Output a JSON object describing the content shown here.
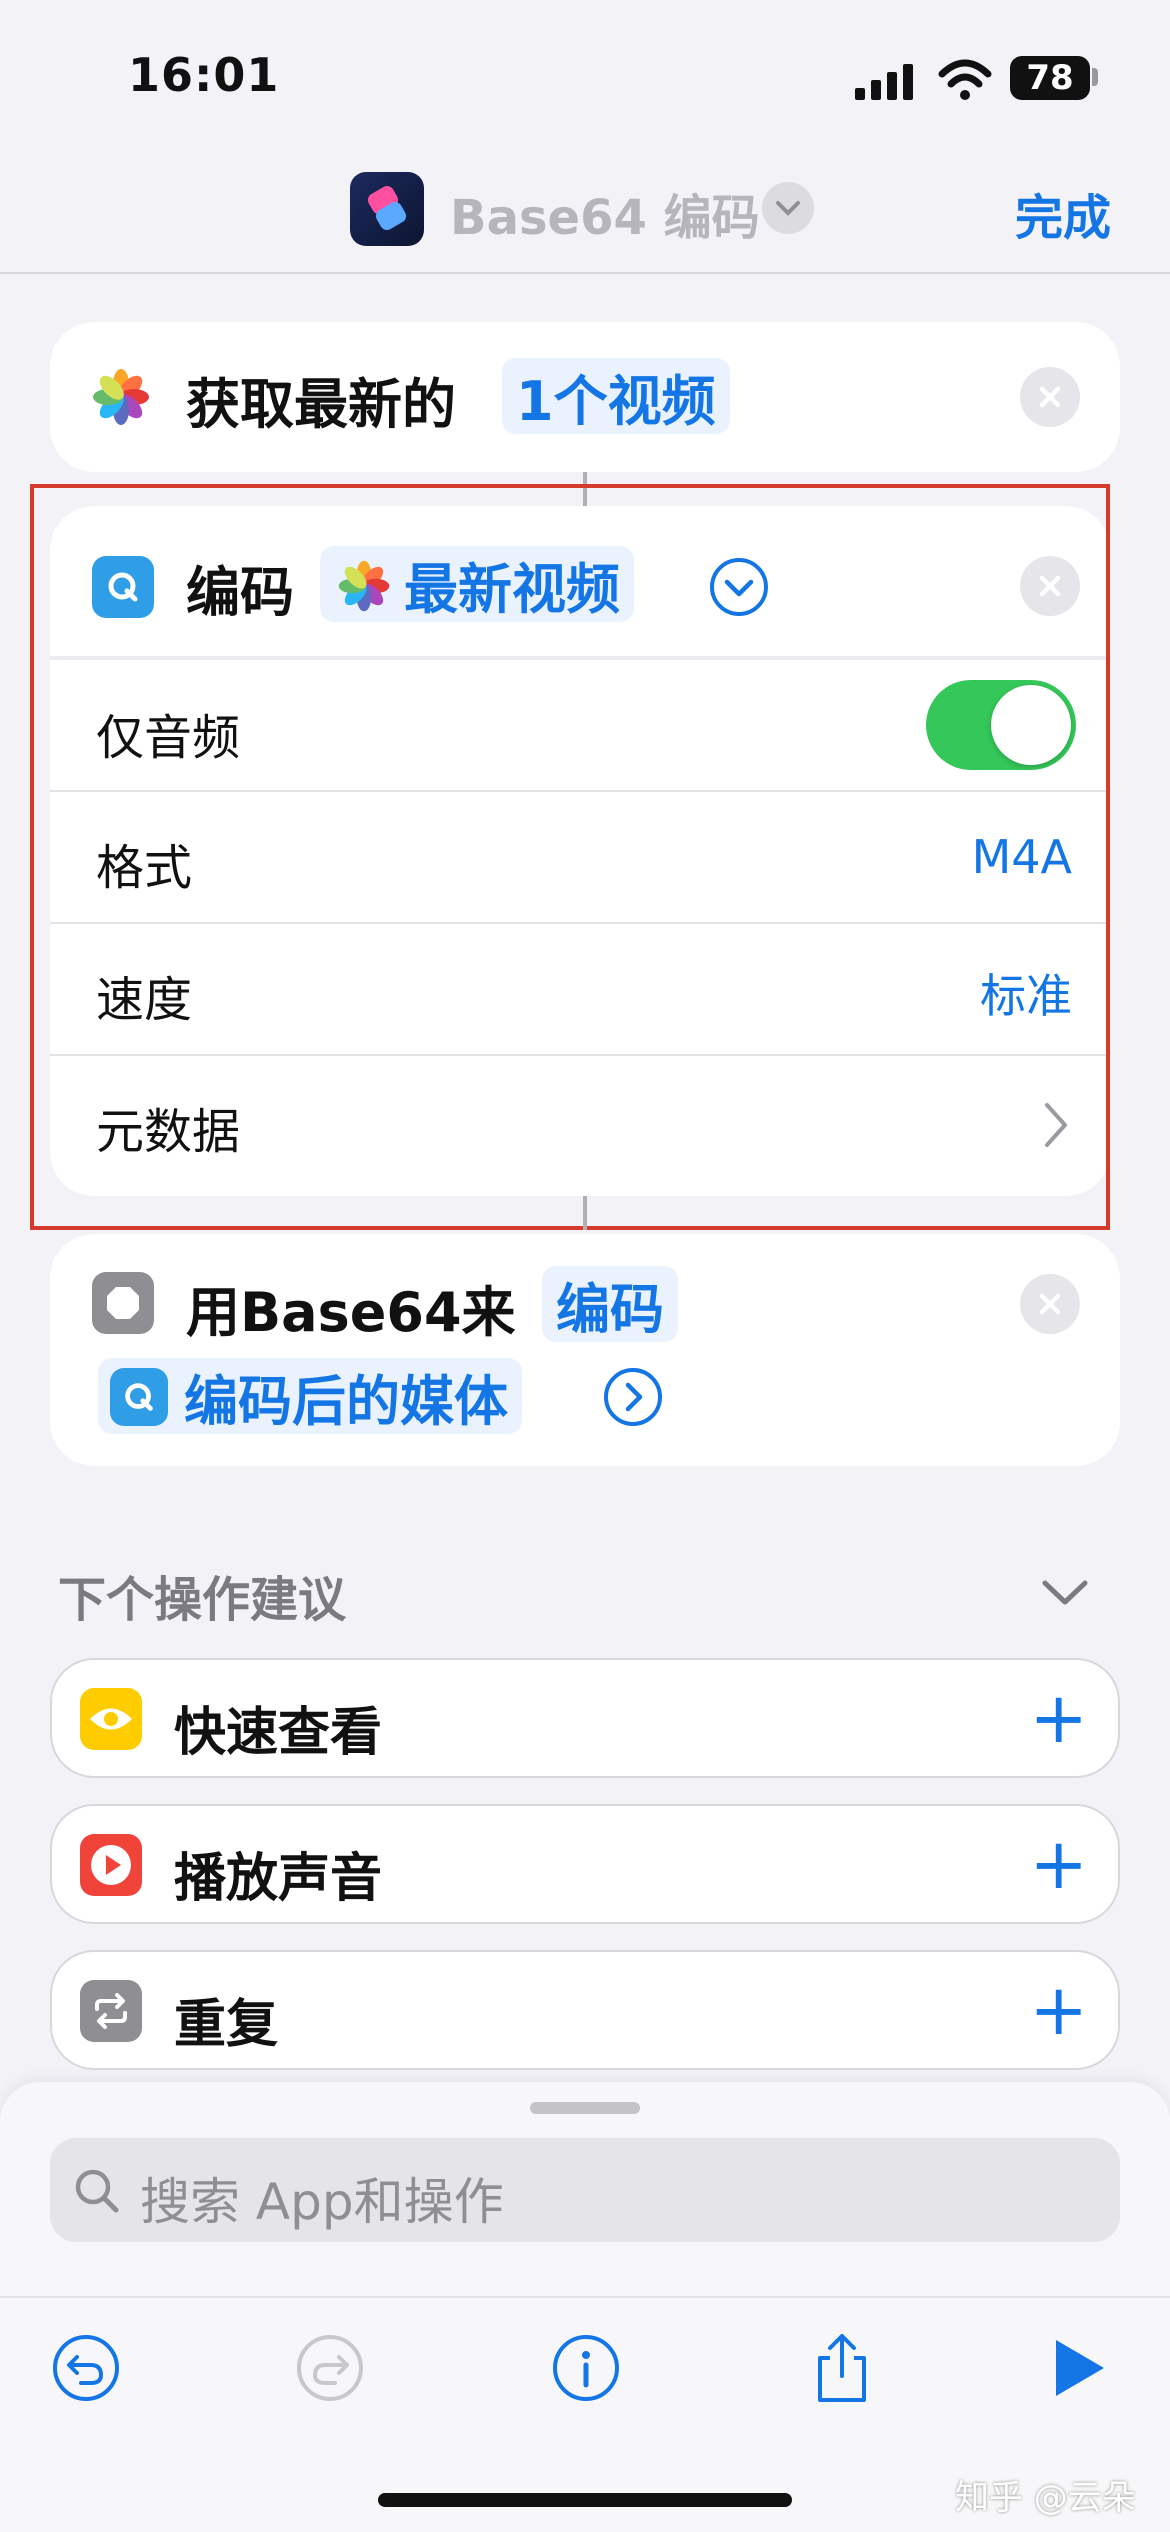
{
  "status_bar": {
    "time": "16:01",
    "battery": "78"
  },
  "nav": {
    "title": "Base64 编码",
    "done": "完成"
  },
  "action1": {
    "text": "获取最新的",
    "token": "1个视频"
  },
  "action2": {
    "verb": "编码",
    "token": "最新视频",
    "rows": [
      {
        "label": "仅音频",
        "value": "",
        "toggle_on": true
      },
      {
        "label": "格式",
        "value": "M4A"
      },
      {
        "label": "速度",
        "value": "标准"
      },
      {
        "label": "元数据",
        "value": ""
      }
    ]
  },
  "action3": {
    "prefix": "用",
    "mid": "Base64",
    "suffix": "来",
    "token": "编码",
    "token2": "编码后的媒体"
  },
  "suggestions": {
    "header": "下个操作建议",
    "items": [
      {
        "label": "快速查看",
        "icon": "eye-icon",
        "color": "#ffcc00"
      },
      {
        "label": "播放声音",
        "icon": "play-icon",
        "color": "#f0433a"
      },
      {
        "label": "重复",
        "icon": "repeat-icon",
        "color": "#8e8e93"
      }
    ]
  },
  "search": {
    "placeholder": "搜索 App和操作"
  },
  "watermark": "知乎 @云朵"
}
